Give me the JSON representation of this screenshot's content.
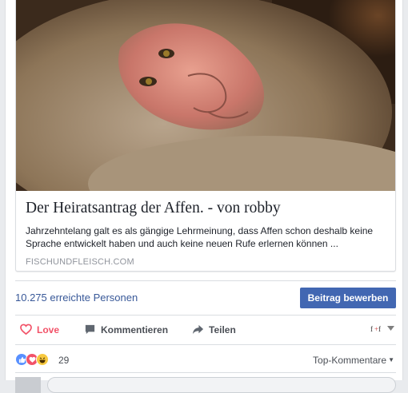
{
  "link": {
    "title": "Der Heiratsantrag der Affen. - von robby",
    "description": "Jahrzehntelang galt es als gängige Lehrmeinung, dass Affen schon deshalb keine Sprache entwickelt haben und auch keine neuen Rufe erlernen können ...",
    "domain": "FISCHUNDFLEISCH.COM",
    "image_icon": "monkey-photo"
  },
  "reach": {
    "text": "10.275 erreichte Personen",
    "boost_label": "Beitrag bewerben"
  },
  "actions": {
    "love_label": "Love",
    "comment_label": "Kommentieren",
    "share_label": "Teilen"
  },
  "reactions": {
    "count": "29",
    "sort_label": "Top-Kommentare"
  },
  "colors": {
    "brand_blue": "#4267b2",
    "link_blue": "#385898",
    "love_red": "#f25268"
  }
}
